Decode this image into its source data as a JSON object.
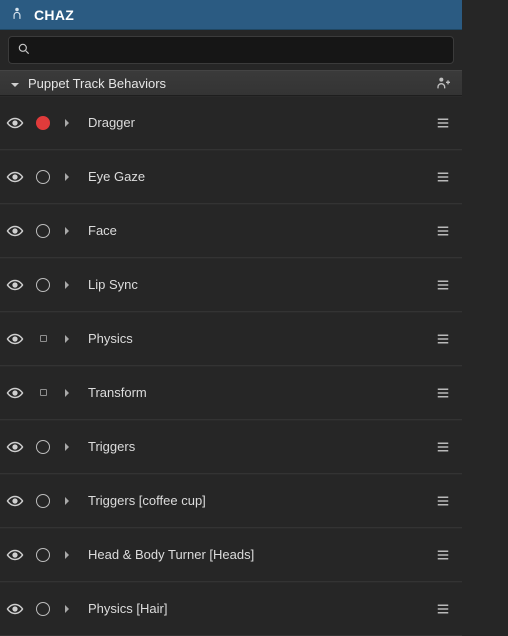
{
  "header": {
    "title": "CHAZ"
  },
  "search": {
    "placeholder": ""
  },
  "section": {
    "label": "Puppet Track Behaviors"
  },
  "behaviors": [
    {
      "name": "Dragger",
      "arm": "active"
    },
    {
      "name": "Eye Gaze",
      "arm": "circle"
    },
    {
      "name": "Face",
      "arm": "circle"
    },
    {
      "name": "Lip Sync",
      "arm": "circle"
    },
    {
      "name": "Physics",
      "arm": "square"
    },
    {
      "name": "Transform",
      "arm": "square"
    },
    {
      "name": "Triggers",
      "arm": "circle"
    },
    {
      "name": "Triggers [coffee cup]",
      "arm": "circle"
    },
    {
      "name": "Head & Body Turner [Heads]",
      "arm": "circle"
    },
    {
      "name": "Physics [Hair]",
      "arm": "circle"
    }
  ]
}
